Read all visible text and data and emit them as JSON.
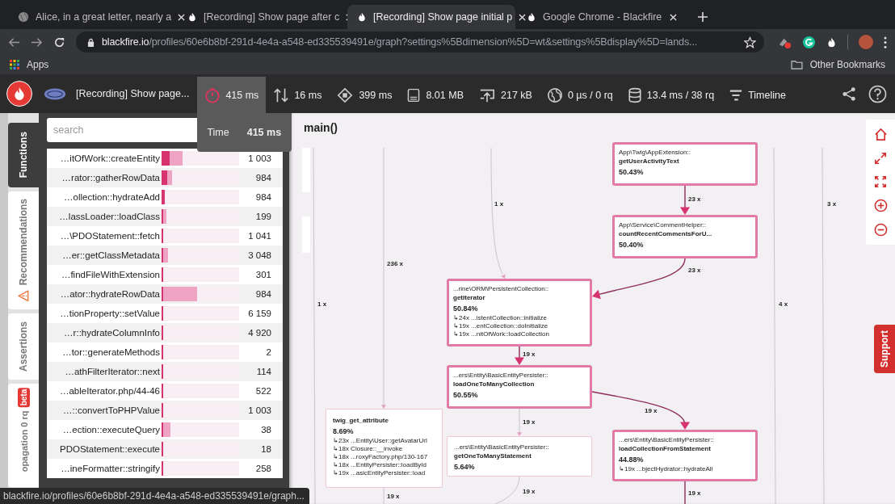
{
  "browser": {
    "tabs": [
      {
        "title": "Alice, in a great letter, nearly a",
        "kind": "globe",
        "selected": false
      },
      {
        "title": "[Recording] Show page after c",
        "kind": "flame",
        "selected": false
      },
      {
        "title": "[Recording] Show page initial p",
        "kind": "flame",
        "selected": true
      },
      {
        "title": "Google Chrome - Blackfire",
        "kind": "flame",
        "selected": false
      }
    ],
    "url": {
      "host": "blackfire.io",
      "path": "/profiles/60e6b8bf-291d-4e4a-a548-ed335539491e/graph?settings%5Bdimension%5D=wt&settings%5Bdisplay%5D=lands..."
    },
    "bookmarks": {
      "apps": "Apps",
      "other": "Other Bookmarks"
    }
  },
  "toolbar": {
    "profile_title": "[Recording] Show page...",
    "metrics": [
      {
        "kind": "time",
        "value": "415 ms",
        "selected": true
      },
      {
        "kind": "io",
        "value": "16 ms",
        "selected": false
      },
      {
        "kind": "cpu",
        "value": "399 ms",
        "selected": false
      },
      {
        "kind": "memory",
        "value": "8.01 MB",
        "selected": false
      },
      {
        "kind": "network",
        "value": "217 kB",
        "selected": false
      },
      {
        "kind": "http",
        "value": "0 µs / 0 rq",
        "selected": false
      },
      {
        "kind": "sql",
        "value": "13.4 ms / 38 rq",
        "selected": false
      },
      {
        "kind": "timeline",
        "value": "Timeline",
        "selected": false
      }
    ],
    "tooltip": {
      "label": "Time",
      "value": "415 ms"
    }
  },
  "side_tabs": [
    {
      "label": "Functions",
      "selected": true,
      "warning": false
    },
    {
      "label": "Recommendations",
      "selected": false,
      "warning": true
    },
    {
      "label": "Assertions",
      "selected": false,
      "warning": false
    },
    {
      "label": "opagation 0 rq",
      "selected": false,
      "warning": false,
      "badge": "beta"
    }
  ],
  "search": {
    "placeholder": "search"
  },
  "functions": [
    {
      "name": "…itOfWork::createEntity",
      "count": "1 003",
      "exclusive": {
        "level": 0.1
      },
      "inclusive": {
        "level": 0.27
      }
    },
    {
      "name": "…rator::gatherRowData",
      "count": "984",
      "exclusive": {
        "level": 0.07
      },
      "inclusive": {
        "level": 0.14
      }
    },
    {
      "name": "…ollection::hydrateAdd",
      "count": "984",
      "exclusive": {
        "level": 0.04
      },
      "inclusive": {
        "level": 0.04
      }
    },
    {
      "name": "…lassLoader::loadClass",
      "count": "199",
      "exclusive": {
        "level": 0.02
      },
      "inclusive": {
        "level": 0.06
      }
    },
    {
      "name": "…\\PDOStatement::fetch",
      "count": "1 041",
      "exclusive": {
        "level": 0.02
      },
      "inclusive": {
        "level": 0.02
      }
    },
    {
      "name": "…er::getClassMetadata",
      "count": "3 048",
      "exclusive": {
        "level": 0.02
      },
      "inclusive": {
        "level": 0.08
      }
    },
    {
      "name": "…findFileWithExtension",
      "count": "301",
      "exclusive": {
        "level": 0.02
      },
      "inclusive": {
        "level": 0.02
      }
    },
    {
      "name": "…ator::hydrateRowData",
      "count": "984",
      "exclusive": {
        "level": 0.02
      },
      "inclusive": {
        "level": 0.46
      }
    },
    {
      "name": "…tionProperty::setValue",
      "count": "6 159",
      "exclusive": {
        "level": 0.02
      },
      "inclusive": {
        "level": 0.02
      }
    },
    {
      "name": "…r::hydrateColumnInfo",
      "count": "4 920",
      "exclusive": {
        "level": 0.02
      },
      "inclusive": {
        "level": 0.02
      }
    },
    {
      "name": "…tor::generateMethods",
      "count": "2",
      "exclusive": {
        "level": 0.02
      },
      "inclusive": {
        "level": 0.02
      }
    },
    {
      "name": "…athFilterIterator::next",
      "count": "114",
      "exclusive": {
        "level": 0.02
      },
      "inclusive": {
        "level": 0.02
      }
    },
    {
      "name": "…ableIterator.php/44-46",
      "count": "522",
      "exclusive": {
        "level": 0.02
      },
      "inclusive": {
        "level": 0.02
      }
    },
    {
      "name": "…::convertToPHPValue",
      "count": "1 003",
      "exclusive": {
        "level": 0.02
      },
      "inclusive": {
        "level": 0.02
      }
    },
    {
      "name": "…ection::executeQuery",
      "count": "38",
      "exclusive": {
        "level": 0.02
      },
      "inclusive": {
        "level": 0.11
      }
    },
    {
      "name": "PDOStatement::execute",
      "count": "18",
      "exclusive": {
        "level": 0.02
      },
      "inclusive": {
        "level": 0.02
      }
    },
    {
      "name": "…ineFormatter::stringify",
      "count": "258",
      "exclusive": {
        "level": 0.02
      },
      "inclusive": {
        "level": 0.02
      }
    }
  ],
  "graph": {
    "title": "main()",
    "nodes": [
      {
        "kind": "hot",
        "namespace": "App\\Twig\\AppExtension::",
        "method": "getUserActivityText",
        "percent": "50.43%"
      },
      {
        "kind": "hot",
        "namespace": "App\\Service\\CommentHelper::",
        "method": "countRecentCommentsForU...",
        "percent": "50.40%"
      },
      {
        "kind": "hot",
        "namespace": "...rine\\ORM\\PersistentCollection::",
        "method": "getIterator",
        "percent": "50.84%",
        "calls": [
          "↳24x ...istentCollection::initialize",
          "↳19x ...entCollection::doInitialize",
          "↳19x ...nitOfWork::loadCollection"
        ]
      },
      {
        "kind": "hot",
        "namespace": "...ers\\Entity\\BasicEntityPersister::",
        "method": "loadOneToManyCollection",
        "percent": "50.55%"
      },
      {
        "kind": "cold",
        "method": "twig_get_attribute",
        "percent": "8.69%",
        "calls": [
          "↳23x ...Entity\\User::getAvatarUrl",
          "↳18x Closure::__invoke",
          "↳18x ...roxyFactory.php/130-167",
          "↳18x ...EntityPersister::loadById",
          "↳19x ...asicEntityPersister::load"
        ]
      },
      {
        "kind": "cold",
        "namespace": "...ers\\Entity\\BasicEntityPersister::",
        "method": "getOneToManyStatement",
        "percent": "5.64%"
      },
      {
        "kind": "hot",
        "namespace": "...ers\\Entity\\BasicEntityPersister::",
        "method": "loadCollectionFromStatement",
        "percent": "44.88%",
        "calls": [
          "↳19x ...bjectHydrator::hydrateAll"
        ]
      }
    ],
    "edges": [
      {
        "label": "1 x",
        "kind": "cold"
      },
      {
        "label": "236 x",
        "kind": "cold"
      },
      {
        "label": "1 x",
        "kind": "cold"
      },
      {
        "label": "23 x",
        "kind": "hot"
      },
      {
        "label": "23 x",
        "kind": "hot"
      },
      {
        "label": "4 x",
        "kind": "cold"
      },
      {
        "label": "3 x",
        "kind": "cold"
      },
      {
        "label": "19 x",
        "kind": "hot"
      },
      {
        "label": "19 x",
        "kind": "cold"
      },
      {
        "label": "19 x",
        "kind": "hot"
      },
      {
        "label": "19 x",
        "kind": "cold"
      },
      {
        "label": "19 x",
        "kind": "cold"
      },
      {
        "label": "19 x",
        "kind": "hot"
      }
    ]
  },
  "support": {
    "label": "Support"
  },
  "status_bar": "blackfire.io/profiles/60e6b8bf-291d-4e4a-a548-ed335539491e/graph..."
}
